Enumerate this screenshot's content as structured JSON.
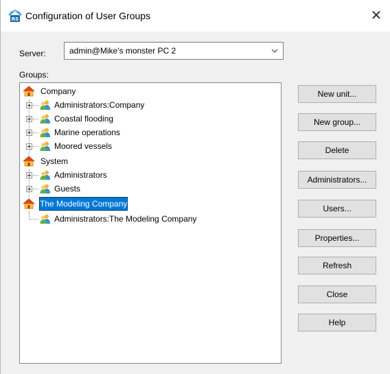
{
  "window": {
    "title": "Configuration of User Groups",
    "close_glyph": "✕"
  },
  "server": {
    "label": "Server:",
    "value": "admin@Mike's monster PC 2"
  },
  "groups": {
    "label": "Groups:",
    "tree": [
      {
        "label": "Company",
        "type": "unit",
        "icon": "house-icon"
      },
      {
        "label": "Administrators:Company",
        "type": "group",
        "icon": "users-icon"
      },
      {
        "label": "Coastal flooding",
        "type": "group",
        "icon": "users-icon"
      },
      {
        "label": "Marine operations",
        "type": "group",
        "icon": "users-icon"
      },
      {
        "label": "Moored vessels",
        "type": "group",
        "icon": "users-icon"
      },
      {
        "label": "System",
        "type": "unit",
        "icon": "house-icon"
      },
      {
        "label": "Administrators",
        "type": "group",
        "icon": "users-icon"
      },
      {
        "label": "Guests",
        "type": "group",
        "icon": "users-icon"
      },
      {
        "label": "The Modeling Company",
        "type": "unit",
        "icon": "house-icon",
        "selected": true
      },
      {
        "label": "Administrators:The Modeling Company",
        "type": "group",
        "icon": "users-icon"
      }
    ]
  },
  "buttons": {
    "new_unit": "New unit...",
    "new_group": "New group...",
    "delete": "Delete",
    "administrators": "Administrators...",
    "users": "Users...",
    "properties": "Properties...",
    "refresh": "Refresh",
    "close": "Close",
    "help": "Help"
  },
  "colors": {
    "selection": "#0078d7",
    "dialog_bg": "#f0f0f0",
    "button_bg": "#e1e1e1"
  }
}
